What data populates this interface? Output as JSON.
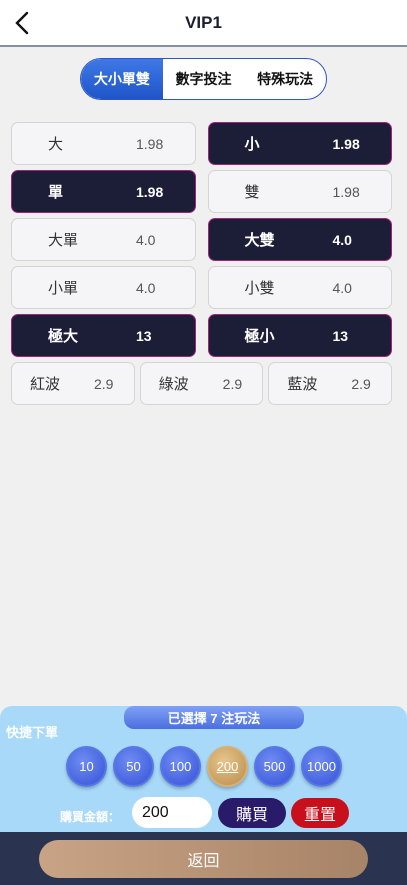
{
  "header": {
    "title": "VIP1",
    "back_icon": "chevron-left-icon"
  },
  "tabs": [
    {
      "label": "大小單雙",
      "active": true
    },
    {
      "label": "數字投注",
      "active": false
    },
    {
      "label": "特殊玩法",
      "active": false
    }
  ],
  "bets": {
    "r0": [
      {
        "name": "大",
        "odds": "1.98",
        "selected": false
      },
      {
        "name": "小",
        "odds": "1.98",
        "selected": true
      }
    ],
    "r1": [
      {
        "name": "單",
        "odds": "1.98",
        "selected": true
      },
      {
        "name": "雙",
        "odds": "1.98",
        "selected": false
      }
    ],
    "r2": [
      {
        "name": "大單",
        "odds": "4.0",
        "selected": false
      },
      {
        "name": "大雙",
        "odds": "4.0",
        "selected": true
      }
    ],
    "r3": [
      {
        "name": "小單",
        "odds": "4.0",
        "selected": false
      },
      {
        "name": "小雙",
        "odds": "4.0",
        "selected": false
      }
    ],
    "r4": [
      {
        "name": "極大",
        "odds": "13",
        "selected": true
      },
      {
        "name": "極小",
        "odds": "13",
        "selected": true
      }
    ],
    "r5": [
      {
        "name": "紅波",
        "odds": "2.9",
        "selected": false
      },
      {
        "name": "綠波",
        "odds": "2.9",
        "selected": false
      },
      {
        "name": "藍波",
        "odds": "2.9",
        "selected": false
      }
    ]
  },
  "panel": {
    "chosen_text": "已選擇 7 注玩法",
    "quick_label": "快捷下單",
    "chips": [
      "10",
      "50",
      "100",
      "200",
      "500",
      "1000"
    ],
    "active_chip": "200",
    "amount_label": "購買金額：",
    "amount_value": "200",
    "buy_label": "購買",
    "reset_label": "重置"
  },
  "footer": {
    "return_label": "返回"
  },
  "colors": {
    "accent_blue": "#1f55c8",
    "selected_bg": "#1c1d36",
    "selected_border": "#a3217f",
    "reset_red": "#c8101c",
    "buy_purple": "#2a1a6a"
  }
}
